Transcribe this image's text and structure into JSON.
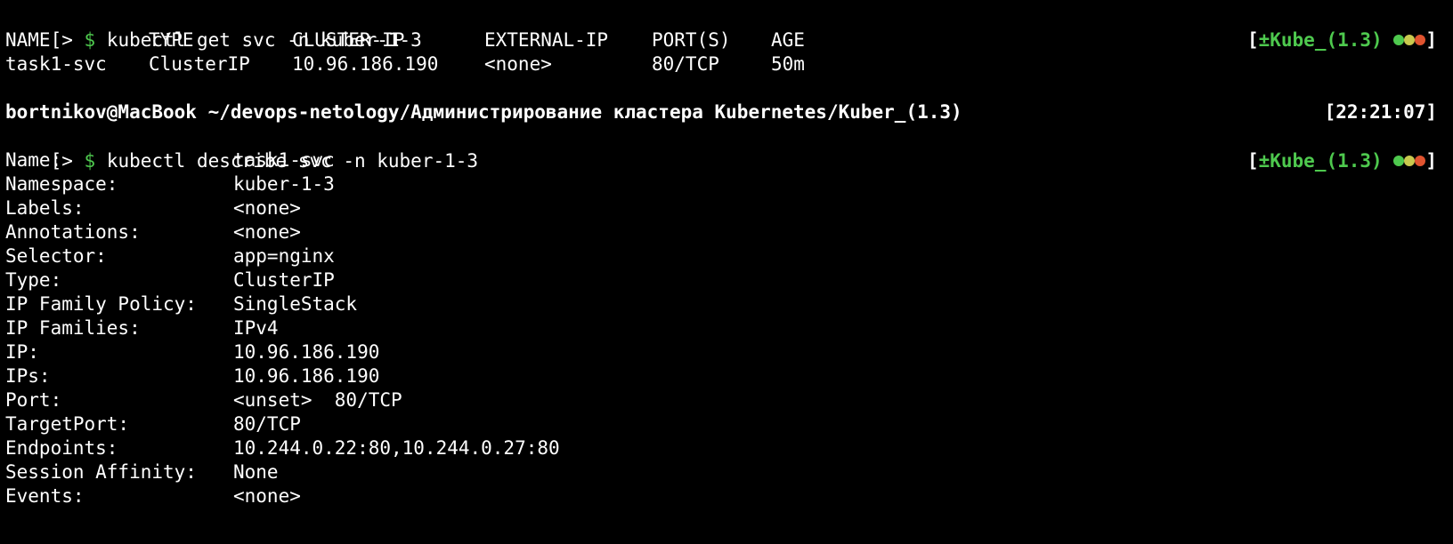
{
  "prompt1": {
    "prefix": "[> ",
    "dollar": "$",
    "command": " kubectl get svc -n kuber-1-3",
    "status_open": "[",
    "status_pm": "±",
    "status_text": "Kube_(1.3)",
    "status_close": "]"
  },
  "svc_table": {
    "headers": [
      "NAME",
      "TYPE",
      "CLUSTER-IP",
      "EXTERNAL-IP",
      "PORT(S)",
      "AGE"
    ],
    "row": [
      "task1-svc",
      "ClusterIP",
      "10.96.186.190",
      "<none>",
      "80/TCP",
      "50m"
    ]
  },
  "header_line": {
    "path": "bortnikov@MacBook ~/devops-netology/Администрирование кластера Kubernetes/Kuber_(1.3)",
    "time": "[22:21:07]"
  },
  "prompt2": {
    "prefix": "[> ",
    "dollar": "$",
    "command": " kubectl describe svc -n kuber-1-3",
    "status_open": "[",
    "status_pm": "±",
    "status_text": "Kube_(1.3)",
    "status_close": "]"
  },
  "describe": [
    {
      "key": "Name:",
      "value": "task1-svc"
    },
    {
      "key": "Namespace:",
      "value": "kuber-1-3"
    },
    {
      "key": "Labels:",
      "value": "<none>"
    },
    {
      "key": "Annotations:",
      "value": "<none>"
    },
    {
      "key": "Selector:",
      "value": "app=nginx"
    },
    {
      "key": "Type:",
      "value": "ClusterIP"
    },
    {
      "key": "IP Family Policy:",
      "value": "SingleStack"
    },
    {
      "key": "IP Families:",
      "value": "IPv4"
    },
    {
      "key": "IP:",
      "value": "10.96.186.190"
    },
    {
      "key": "IPs:",
      "value": "10.96.186.190"
    },
    {
      "key": "Port:",
      "value": "<unset>  80/TCP"
    },
    {
      "key": "TargetPort:",
      "value": "80/TCP"
    },
    {
      "key": "Endpoints:",
      "value": "10.244.0.22:80,10.244.0.27:80"
    },
    {
      "key": "Session Affinity:",
      "value": "None"
    },
    {
      "key": "Events:",
      "value": "<none>"
    }
  ],
  "colors": {
    "background": "#000000",
    "text": "#ffffff",
    "prompt_green": "#4ec94e",
    "dot_green": "#4ec94e",
    "dot_yellow": "#c9c94e",
    "dot_red": "#e0532f"
  }
}
